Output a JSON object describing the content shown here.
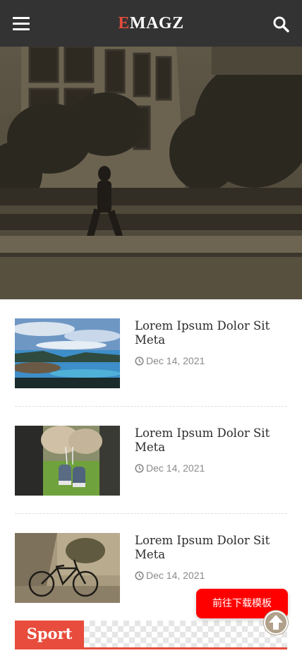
{
  "header": {
    "logo_first": "E",
    "logo_rest": "MAGZ",
    "menu_icon": "hamburger-menu-icon",
    "search_icon": "search-icon",
    "background_color": "#333333",
    "accent_color": "#e74c3c"
  },
  "hero": {
    "slide_count": 5,
    "active_index": 2,
    "active_color": "#e74c3c",
    "inactive_color": "#d6d6d6"
  },
  "articles": [
    {
      "title": "Lorem Ipsum Dolor Sit Meta",
      "date": "Dec 14, 2021",
      "date_icon": "clock-icon"
    },
    {
      "title": "Lorem Ipsum Dolor Sit Meta",
      "date": "Dec 14, 2021",
      "date_icon": "clock-icon"
    },
    {
      "title": "Lorem Ipsum Dolor Sit Meta",
      "date": "Dec 14, 2021",
      "date_icon": "clock-icon"
    }
  ],
  "section": {
    "title": "Sport"
  },
  "download_button": {
    "label": "前往下载模板",
    "color": "#ff0000"
  },
  "back_to_top": {
    "icon": "arrow-up-icon"
  }
}
